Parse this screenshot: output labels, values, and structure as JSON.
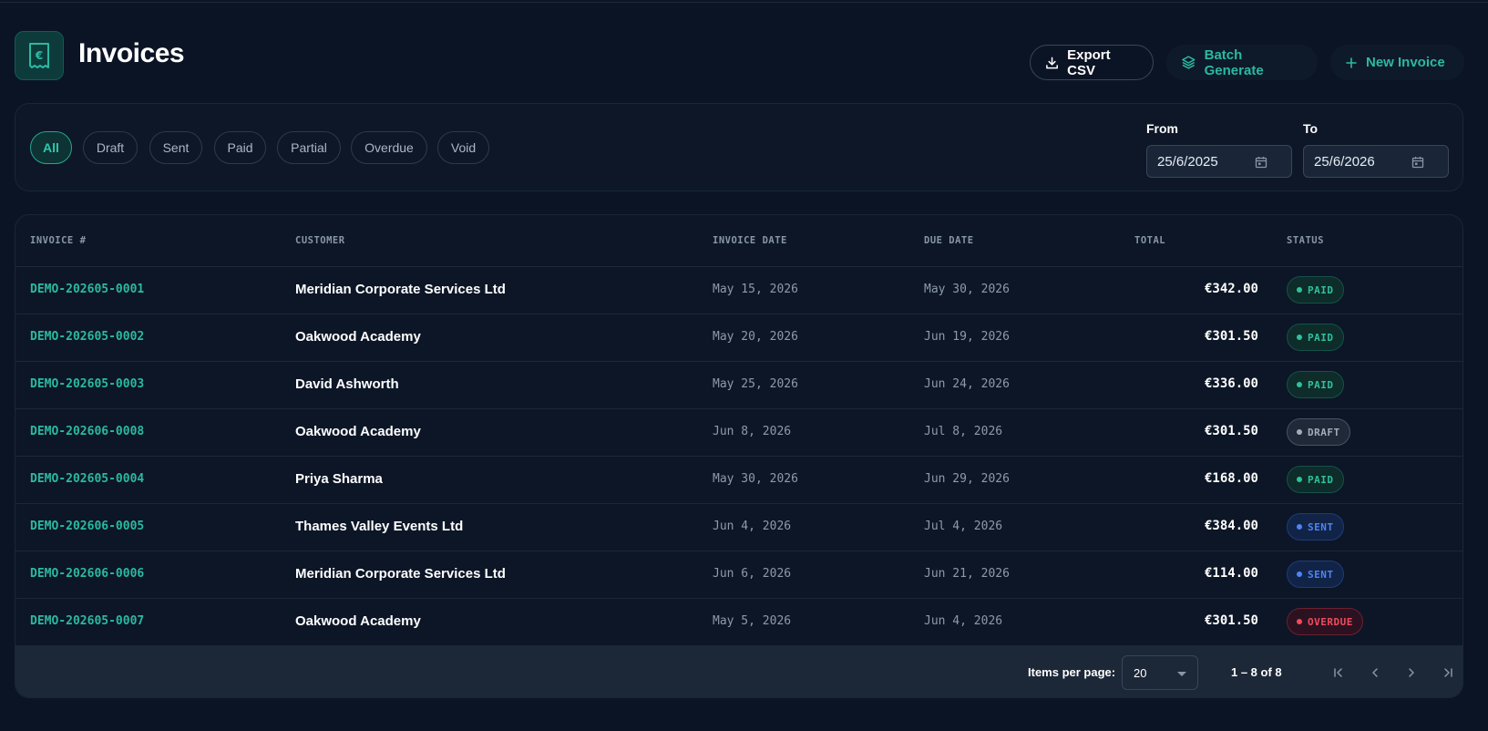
{
  "header": {
    "title": "Invoices",
    "logo_icon": "receipt-euro-icon",
    "buttons": {
      "export": "Export CSV",
      "batch": "Batch Generate",
      "new_invoice": "New Invoice"
    }
  },
  "filters": {
    "chips": [
      "All",
      "Draft",
      "Sent",
      "Paid",
      "Partial",
      "Overdue",
      "Void"
    ],
    "active": "All",
    "from_label": "From",
    "from_value": "25/6/2025",
    "to_label": "To",
    "to_value": "25/6/2026"
  },
  "table": {
    "columns": {
      "invoice": "INVOICE #",
      "customer": "CUSTOMER",
      "invoice_date": "INVOICE DATE",
      "due_date": "DUE DATE",
      "total": "TOTAL",
      "status": "STATUS"
    },
    "rows": [
      {
        "invoice": "DEMO-202605-0001",
        "customer": "Meridian Corporate Services Ltd",
        "invoice_date": "May 15, 2026",
        "due_date": "May 30, 2026",
        "total": "€342.00",
        "status": "PAID"
      },
      {
        "invoice": "DEMO-202605-0002",
        "customer": "Oakwood Academy",
        "invoice_date": "May 20, 2026",
        "due_date": "Jun 19, 2026",
        "total": "€301.50",
        "status": "PAID"
      },
      {
        "invoice": "DEMO-202605-0003",
        "customer": "David Ashworth",
        "invoice_date": "May 25, 2026",
        "due_date": "Jun 24, 2026",
        "total": "€336.00",
        "status": "PAID"
      },
      {
        "invoice": "DEMO-202606-0008",
        "customer": "Oakwood Academy",
        "invoice_date": "Jun 8, 2026",
        "due_date": "Jul 8, 2026",
        "total": "€301.50",
        "status": "DRAFT"
      },
      {
        "invoice": "DEMO-202605-0004",
        "customer": "Priya Sharma",
        "invoice_date": "May 30, 2026",
        "due_date": "Jun 29, 2026",
        "total": "€168.00",
        "status": "PAID"
      },
      {
        "invoice": "DEMO-202606-0005",
        "customer": "Thames Valley Events Ltd",
        "invoice_date": "Jun 4, 2026",
        "due_date": "Jul 4, 2026",
        "total": "€384.00",
        "status": "SENT"
      },
      {
        "invoice": "DEMO-202606-0006",
        "customer": "Meridian Corporate Services Ltd",
        "invoice_date": "Jun 6, 2026",
        "due_date": "Jun 21, 2026",
        "total": "€114.00",
        "status": "SENT"
      },
      {
        "invoice": "DEMO-202605-0007",
        "customer": "Oakwood Academy",
        "invoice_date": "May 5, 2026",
        "due_date": "Jun 4, 2026",
        "total": "€301.50",
        "status": "OVERDUE"
      }
    ]
  },
  "pagination": {
    "items_per_page_label": "Items per page:",
    "items_per_page": "20",
    "range": "1 – 8 of 8"
  },
  "colors": {
    "accent": "#2bb9a1",
    "background": "#0b1424",
    "paid": "#2ec29c",
    "sent": "#4d84f5",
    "overdue": "#ef4b5c",
    "draft": "#a2acba"
  }
}
